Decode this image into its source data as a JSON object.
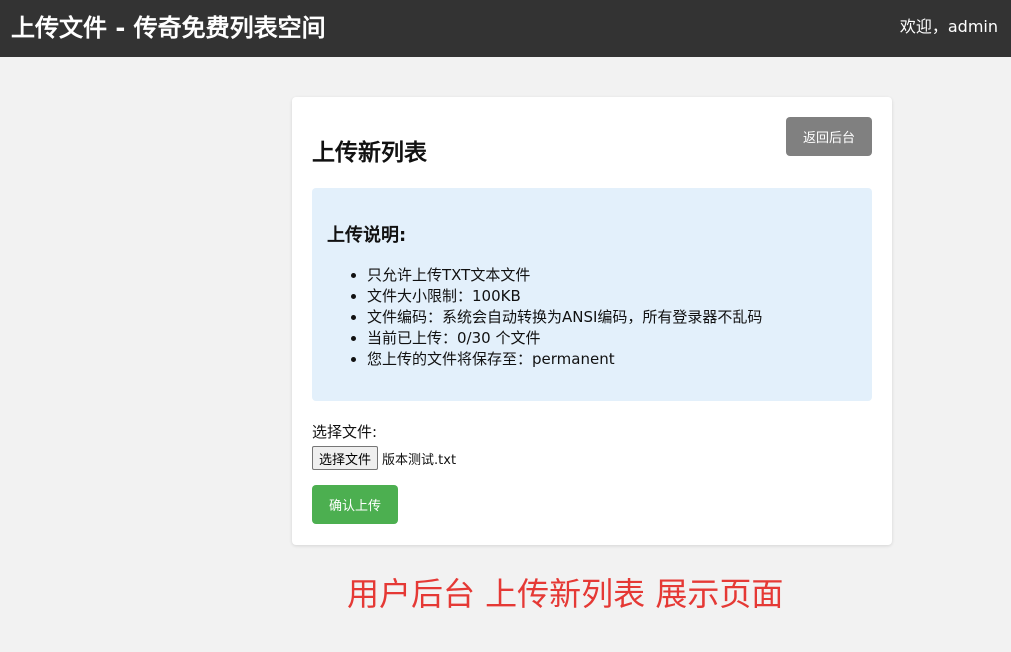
{
  "header": {
    "title": "上传文件 - 传奇免费列表空间",
    "welcome": "欢迎，admin"
  },
  "card": {
    "title": "上传新列表",
    "back_button": "返回后台",
    "notice": {
      "title": "上传说明:",
      "items": [
        "只允许上传TXT文本文件",
        "文件大小限制：100KB",
        "文件编码：系统会自动转换为ANSI编码，所有登录器不乱码",
        "当前已上传：0/30 个文件",
        "您上传的文件将保存至：permanent"
      ]
    },
    "file_label": "选择文件:",
    "choose_button": "选择文件",
    "selected_file": "版本测试.txt",
    "submit_button": "确认上传"
  },
  "caption": "用户后台 上传新列表 展示页面",
  "colors": {
    "header_bg": "#333333",
    "page_bg": "#f2f2f2",
    "notice_bg": "#e3f0fb",
    "back_button_bg": "#808080",
    "submit_button_bg": "#4caf50",
    "caption_color": "#e53935"
  }
}
